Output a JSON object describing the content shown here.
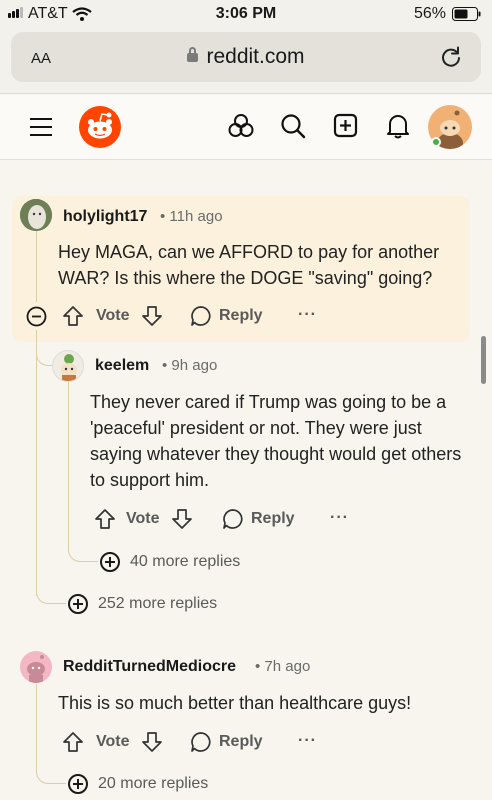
{
  "status": {
    "carrier": "AT&T",
    "time": "3:06 PM",
    "battery": "56%"
  },
  "browser": {
    "text_size": "AA",
    "host": "reddit.com"
  },
  "comments": [
    {
      "user": "holylight17",
      "age": "11h ago",
      "body": "Hey MAGA, can we AFFORD to pay for another WAR? Is this where the DOGE \"saving\" going?",
      "vote": "Vote",
      "reply": "Reply"
    },
    {
      "user": "keelem",
      "age": "9h ago",
      "body": "They never cared if Trump was going to be a 'peaceful' president or not. They were just saying whatever they thought would get others to support him.",
      "vote": "Vote",
      "reply": "Reply",
      "more_replies": "40 more replies"
    },
    {
      "user": "RedditTurnedMediocre",
      "age": "7h ago",
      "body": "This is so much better than healthcare guys!",
      "vote": "Vote",
      "reply": "Reply",
      "more_replies": "20 more replies"
    }
  ],
  "thread_more_replies": "252 more replies",
  "colors": {
    "reddit_orange": "#ff4500",
    "highlight": "#fbf1dc",
    "thread_line": "#d9cfa8",
    "online_green": "#46b04a"
  },
  "icons": [
    "menu-icon",
    "reddit-logo",
    "popular-icon",
    "search-icon",
    "create-post-icon",
    "notifications-icon",
    "collapse-icon",
    "upvote-icon",
    "downvote-icon",
    "reply-icon",
    "more-options-icon",
    "expand-icon",
    "reload-icon",
    "lock-icon",
    "wifi-icon",
    "signal-icon",
    "battery-icon"
  ]
}
